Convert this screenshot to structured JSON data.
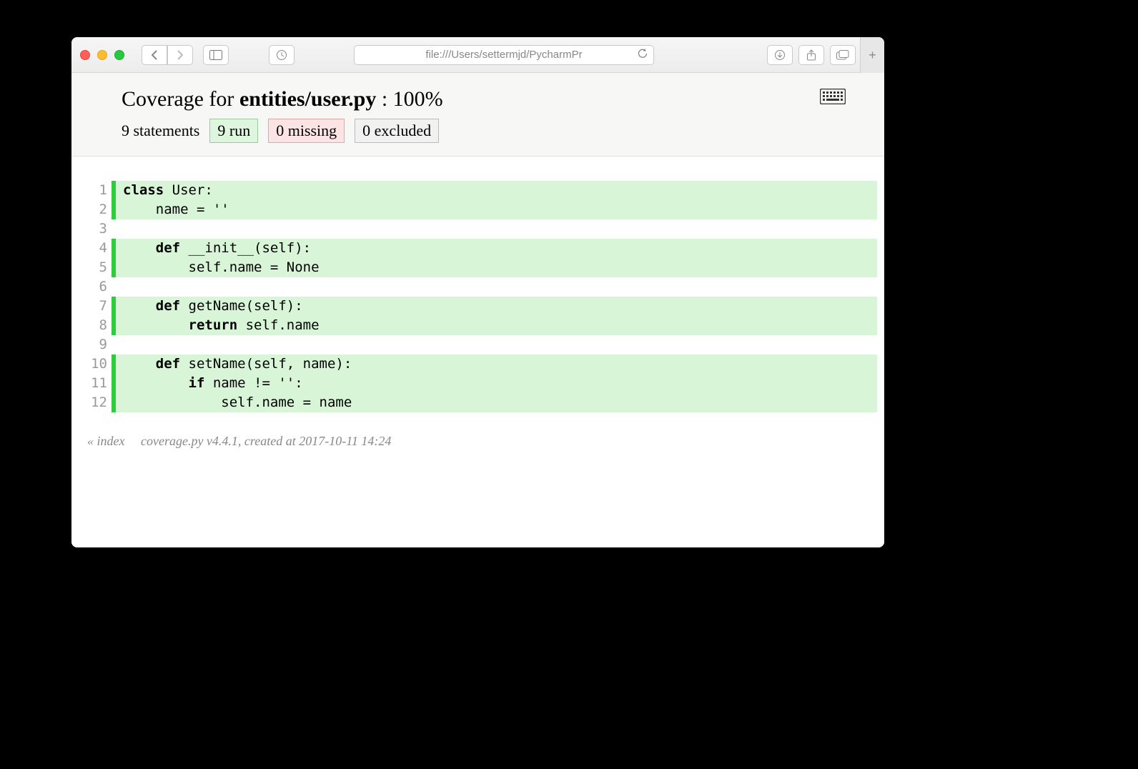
{
  "browser": {
    "url": "file:///Users/settermjd/PycharmPr"
  },
  "header": {
    "prefix": "Coverage for ",
    "filename": "entities/user.py",
    "suffix": " : 100%",
    "statements": "9 statements",
    "run": "9 run",
    "missing": "0 missing",
    "excluded": "0 excluded"
  },
  "code_lines": [
    {
      "n": 1,
      "hit": true,
      "tokens": [
        [
          "kw",
          "class"
        ],
        [
          "",
          " User:"
        ]
      ]
    },
    {
      "n": 2,
      "hit": true,
      "tokens": [
        [
          "",
          "    name = ''"
        ]
      ]
    },
    {
      "n": 3,
      "hit": false,
      "tokens": [
        [
          "",
          ""
        ]
      ]
    },
    {
      "n": 4,
      "hit": true,
      "tokens": [
        [
          "",
          "    "
        ],
        [
          "kw",
          "def"
        ],
        [
          "",
          " __init__(self):"
        ]
      ]
    },
    {
      "n": 5,
      "hit": true,
      "tokens": [
        [
          "",
          "        self.name = None"
        ]
      ]
    },
    {
      "n": 6,
      "hit": false,
      "tokens": [
        [
          "",
          ""
        ]
      ]
    },
    {
      "n": 7,
      "hit": true,
      "tokens": [
        [
          "",
          "    "
        ],
        [
          "kw",
          "def"
        ],
        [
          "",
          " getName(self):"
        ]
      ]
    },
    {
      "n": 8,
      "hit": true,
      "tokens": [
        [
          "",
          "        "
        ],
        [
          "kw",
          "return"
        ],
        [
          "",
          " self.name"
        ]
      ]
    },
    {
      "n": 9,
      "hit": false,
      "tokens": [
        [
          "",
          ""
        ]
      ]
    },
    {
      "n": 10,
      "hit": true,
      "tokens": [
        [
          "",
          "    "
        ],
        [
          "kw",
          "def"
        ],
        [
          "",
          " setName(self, name):"
        ]
      ]
    },
    {
      "n": 11,
      "hit": true,
      "tokens": [
        [
          "",
          "        "
        ],
        [
          "kw",
          "if"
        ],
        [
          "",
          " name != '':"
        ]
      ]
    },
    {
      "n": 12,
      "hit": true,
      "tokens": [
        [
          "",
          "            self.name = name"
        ]
      ]
    }
  ],
  "footer": {
    "back": "« index",
    "meta": "coverage.py v4.4.1, created at 2017-10-11 14:24"
  }
}
